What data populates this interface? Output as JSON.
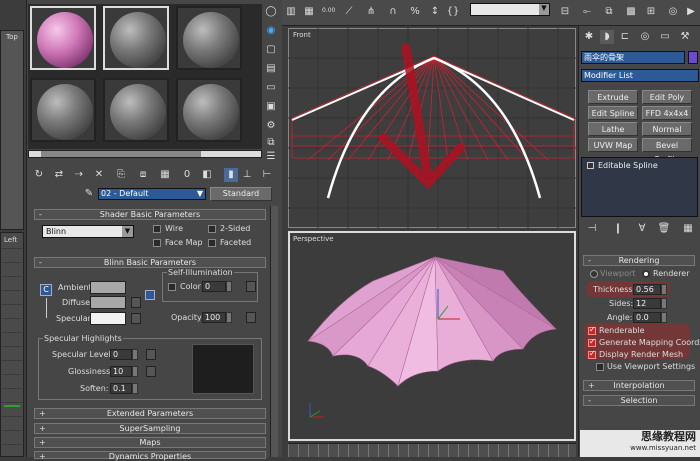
{
  "viewports": {
    "top_label": "Top",
    "front_label": "Front",
    "left_label": "Left",
    "perspective_label": "Perspective"
  },
  "toolbar": {
    "spinner_value": "0.00"
  },
  "material_editor": {
    "material_name": "02 - Default",
    "material_type": "Standard",
    "shader_rollout": "Shader Basic Parameters",
    "shader_type": "Blinn",
    "wire": "Wire",
    "two_sided": "2-Sided",
    "face_map": "Face Map",
    "faceted": "Faceted",
    "blinn_rollout": "Blinn Basic Parameters",
    "self_illum": "Self-Illumination",
    "ambient": "Ambient:",
    "diffuse": "Diffuse:",
    "specular": "Specular:",
    "color": "Color",
    "color_value": "0",
    "opacity": "Opacity:",
    "opacity_value": "100",
    "spec_highlights": "Specular Highlights",
    "spec_level": "Specular Level:",
    "spec_level_value": "0",
    "glossiness": "Glossiness:",
    "glossiness_value": "10",
    "soften": "Soften:",
    "soften_value": "0.1",
    "rollouts": [
      "Extended Parameters",
      "SuperSampling",
      "Maps",
      "Dynamics Properties"
    ],
    "plus": "+",
    "minus": "-",
    "ambient_lock": "C"
  },
  "command_panel": {
    "object_name": "雨伞的骨架",
    "modifier_list": "Modifier List",
    "modifier_buttons": [
      "Extrude",
      "Edit Poly",
      "Edit Spline",
      "FFD 4x4x4",
      "Lathe",
      "Normal",
      "UVW Map",
      "Bevel Profile"
    ],
    "stack_item": "Editable Spline",
    "rendering_rollout": "Rendering",
    "viewport": "Viewport",
    "renderer": "Renderer",
    "thickness": "Thickness:",
    "thickness_value": "0.56",
    "sides": "Sides:",
    "sides_value": "12",
    "angle": "Angle:",
    "angle_value": "0.0",
    "renderable": "Renderable",
    "gen_mapping": "Generate Mapping Coords.",
    "display_render_mesh": "Display Render Mesh",
    "use_viewport": "Use Viewport Settings",
    "interpolation": "Interpolation",
    "selection": "Selection"
  },
  "watermark": {
    "line1": "思缘教程网",
    "line2": "www.missyuan.net"
  },
  "colors": {
    "accent_red": "#c62828",
    "umbrella_pink": "#e8a0d0",
    "wire_red": "#d02030"
  }
}
